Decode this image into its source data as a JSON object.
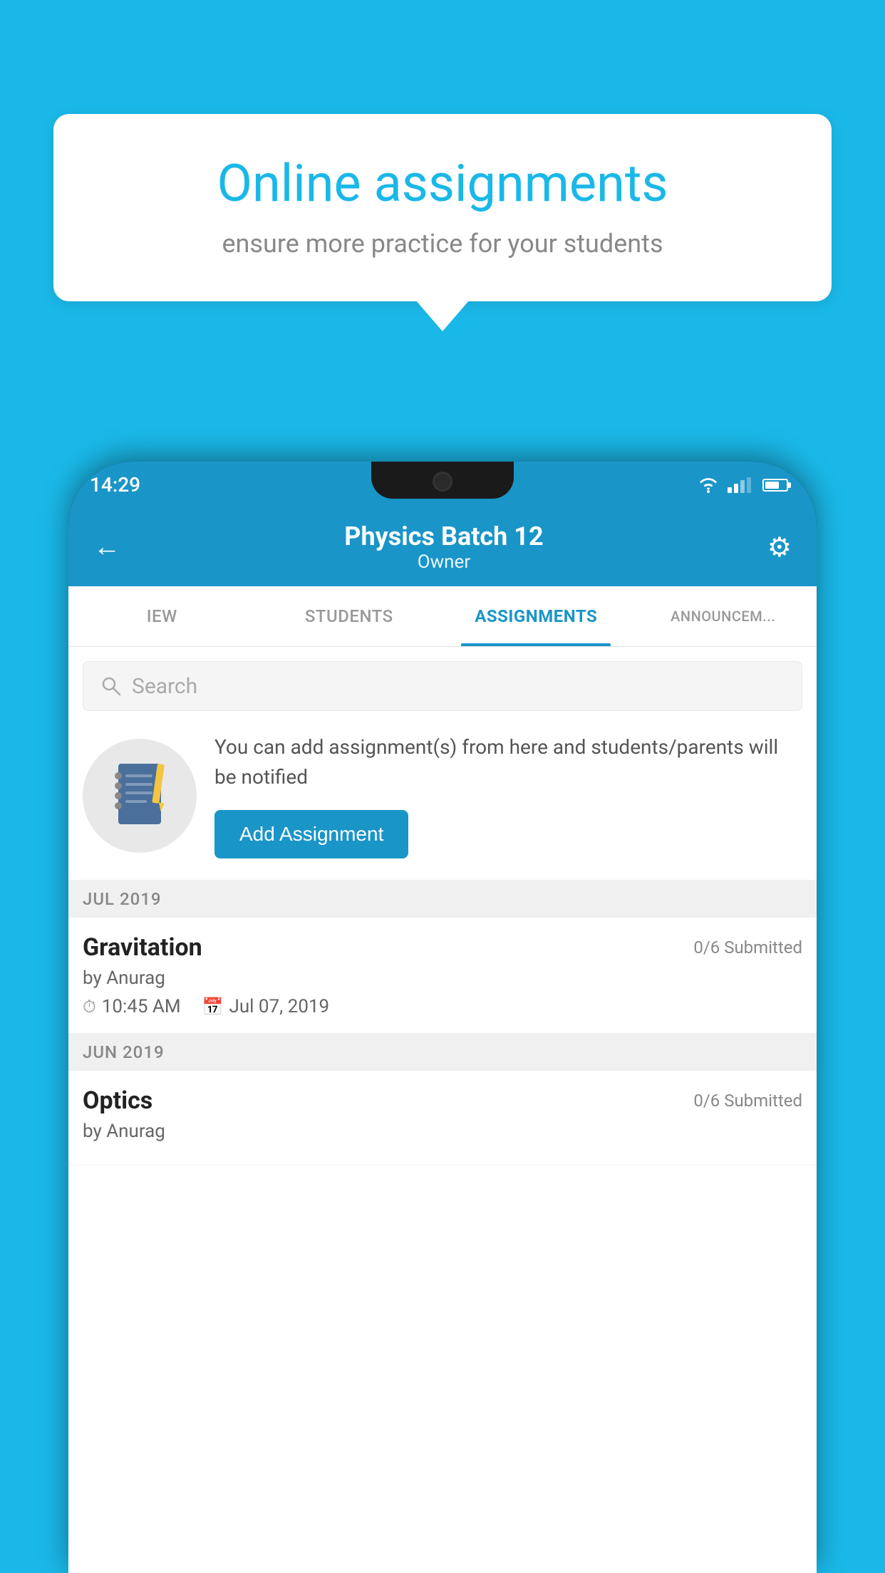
{
  "background_color": "#1ab8e8",
  "speech_bubble": {
    "title": "Online assignments",
    "subtitle": "ensure more practice for your students"
  },
  "status_bar": {
    "time": "14:29"
  },
  "app_header": {
    "title": "Physics Batch 12",
    "subtitle": "Owner"
  },
  "tabs": [
    {
      "label": "IEW",
      "active": false
    },
    {
      "label": "STUDENTS",
      "active": false
    },
    {
      "label": "ASSIGNMENTS",
      "active": true
    },
    {
      "label": "ANNOUNCEM...",
      "active": false
    }
  ],
  "search": {
    "placeholder": "Search"
  },
  "promo": {
    "description": "You can add assignment(s) from here and students/parents will be notified",
    "button_label": "Add Assignment"
  },
  "assignment_sections": [
    {
      "month_label": "JUL 2019",
      "assignments": [
        {
          "name": "Gravitation",
          "submitted": "0/6 Submitted",
          "author": "by Anurag",
          "time": "10:45 AM",
          "date": "Jul 07, 2019"
        }
      ]
    },
    {
      "month_label": "JUN 2019",
      "assignments": [
        {
          "name": "Optics",
          "submitted": "0/6 Submitted",
          "author": "by Anurag",
          "time": "",
          "date": ""
        }
      ]
    }
  ]
}
